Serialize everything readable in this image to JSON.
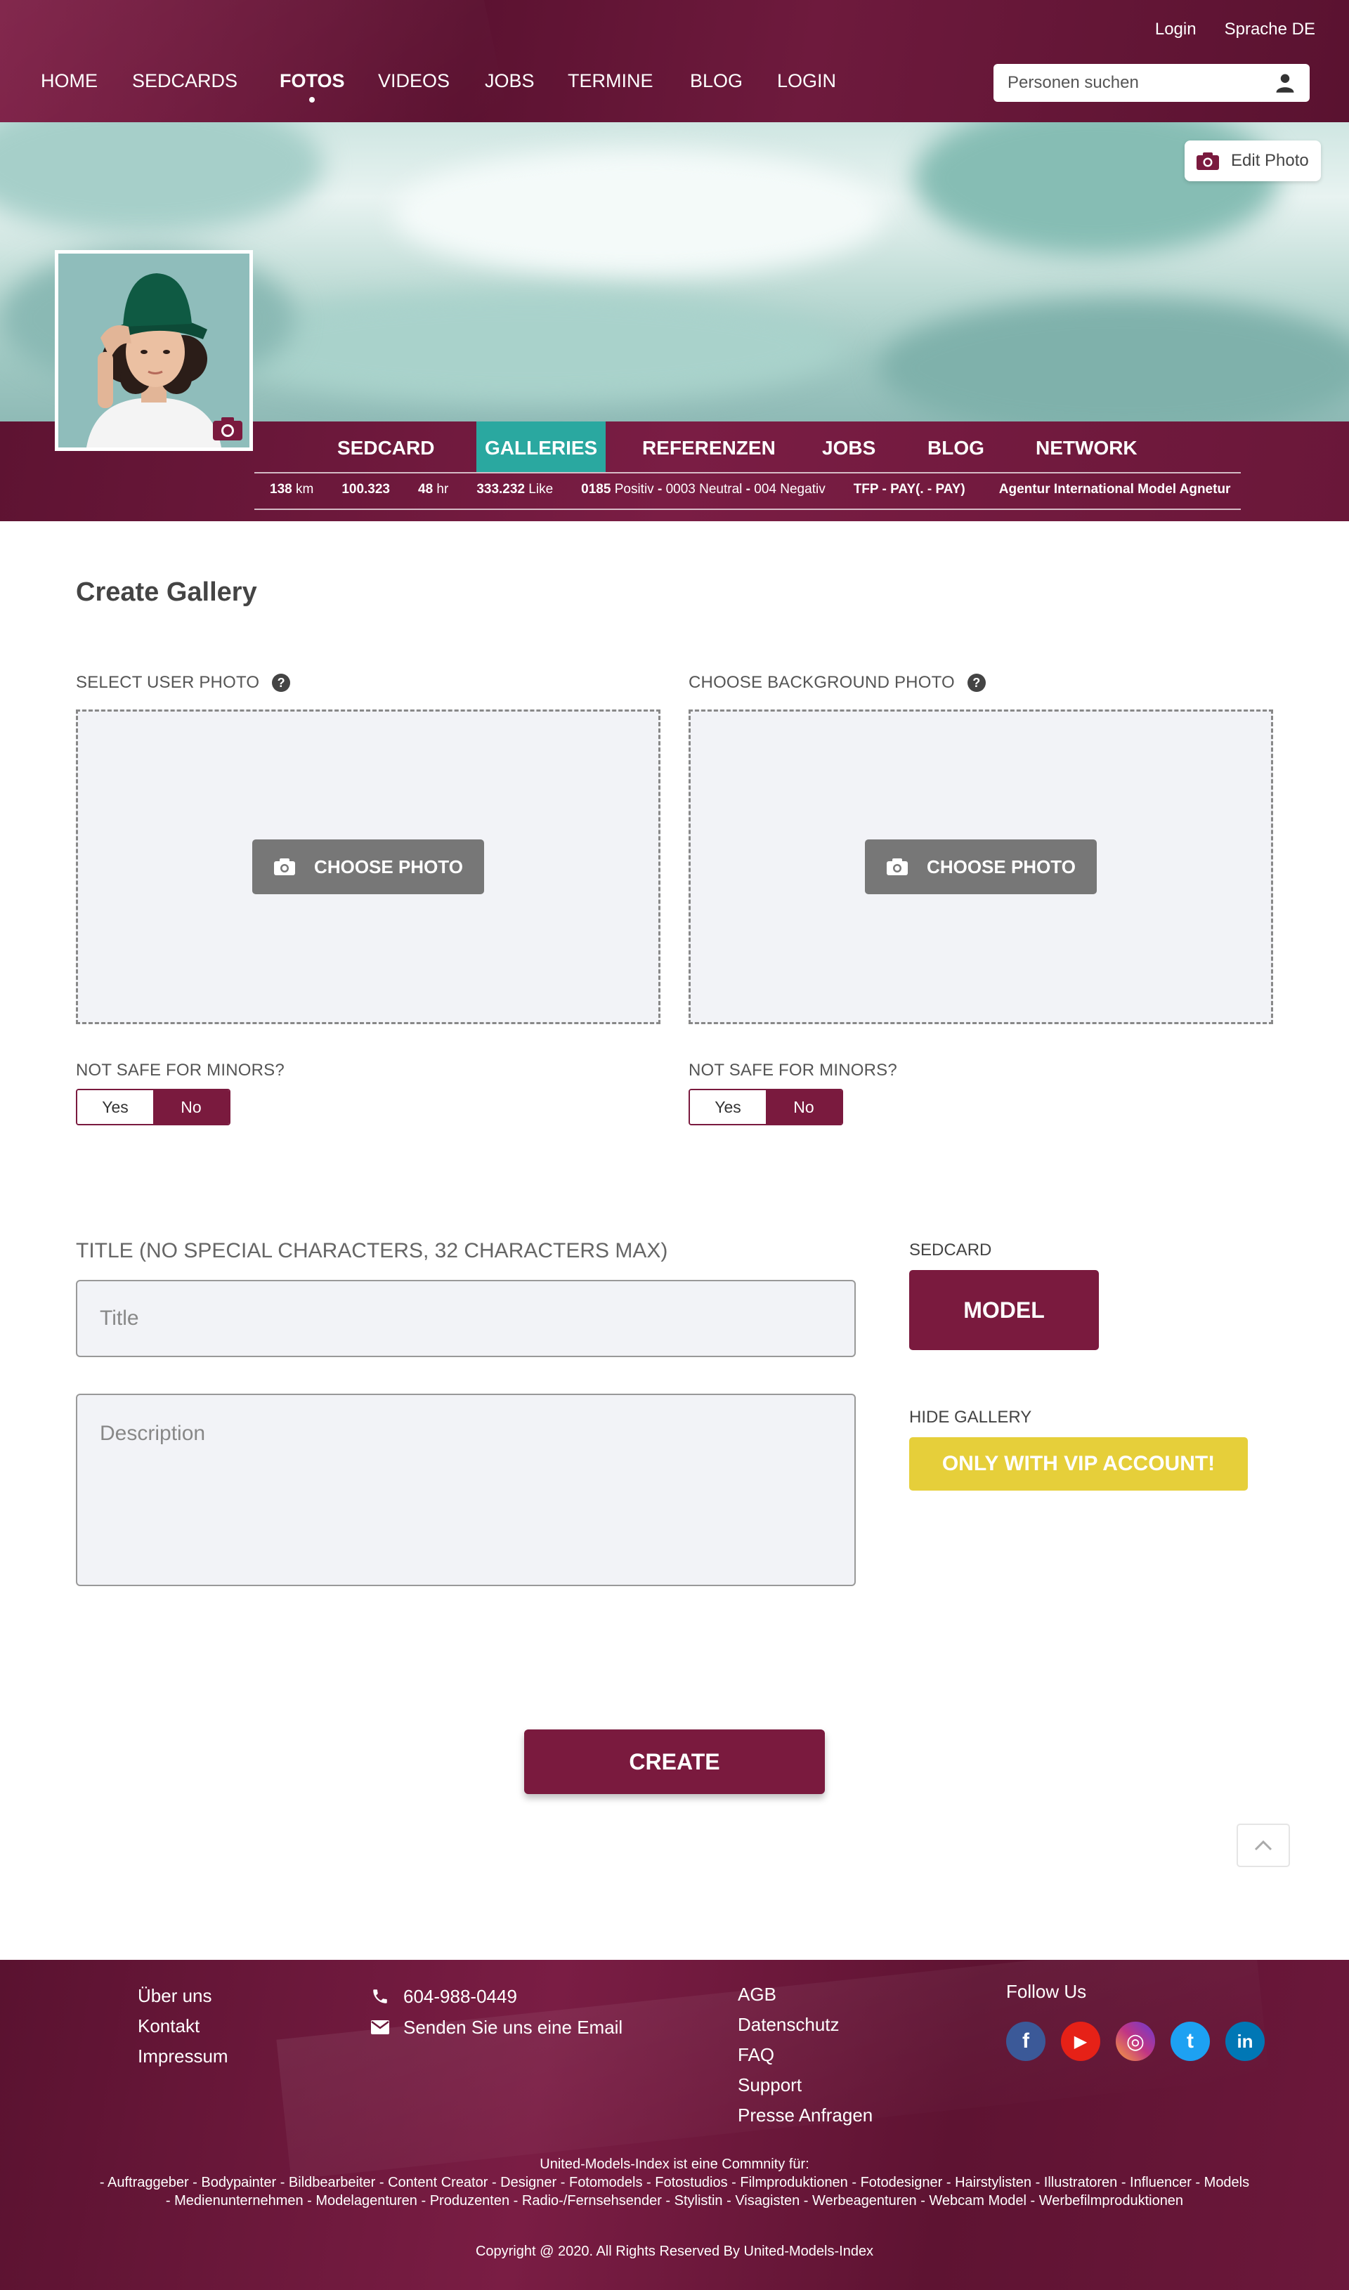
{
  "colors": {
    "brand": "#7a1a3e",
    "brand_dark": "#5c1231",
    "accent_teal": "#2aa8a0",
    "vip_yellow": "#e6cf3a",
    "dropzone_bg": "#f2f3f7"
  },
  "header": {
    "top_links": [
      "Login",
      "Sprache DE"
    ],
    "nav": [
      {
        "label": "HOME",
        "active": false
      },
      {
        "label": "SEDCARDS",
        "active": false
      },
      {
        "label": "FOTOS",
        "active": true
      },
      {
        "label": "VIDEOS",
        "active": false
      },
      {
        "label": "JOBS",
        "active": false
      },
      {
        "label": "TERMINE",
        "active": false
      },
      {
        "label": "BLOG",
        "active": false
      },
      {
        "label": "LOGIN",
        "active": false
      }
    ],
    "search": {
      "placeholder": "Personen suchen",
      "icon": "person-icon"
    }
  },
  "cover": {
    "edit_label": "Edit Photo",
    "edit_icon": "camera-icon"
  },
  "profile": {
    "tabs": [
      {
        "label": "SEDCARD",
        "active": false
      },
      {
        "label": "GALLERIES",
        "active": true
      },
      {
        "label": "REFERENZEN",
        "active": false
      },
      {
        "label": "JOBS",
        "active": false
      },
      {
        "label": "BLOG",
        "active": false
      },
      {
        "label": "NETWORK",
        "active": false
      }
    ],
    "stats": {
      "distance_value": "138",
      "distance_unit": "km",
      "views": "100.323",
      "hours_value": "48",
      "hours_unit": "hr",
      "likes_value": "333.232",
      "likes_unit": "Like",
      "positive_value": "0185",
      "positive_unit": "Positiv",
      "neutral_value": "0003",
      "neutral_unit": "Neutral",
      "negative_value": "004",
      "negative_unit": "Negativ",
      "separator": "-",
      "tfp": "TFP - PAY(. - PAY)",
      "agency": "Agentur International Model Agnetur"
    }
  },
  "form": {
    "title": "Create Gallery",
    "user_photo": {
      "label": "SELECT USER PHOTO",
      "help": "?",
      "button": "CHOOSE PHOTO",
      "nsfw_label": "NOT SAFE FOR MINORS?",
      "yes": "Yes",
      "no": "No",
      "selected": "No"
    },
    "background_photo": {
      "label": "CHOOSE BACKGROUND PHOTO",
      "help": "?",
      "button": "CHOOSE PHOTO",
      "nsfw_label": "NOT SAFE FOR MINORS?",
      "yes": "Yes",
      "no": "No",
      "selected": "No"
    },
    "title_label": "TITLE (NO SPECIAL CHARACTERS, 32 CHARACTERS MAX)",
    "title_placeholder": "Title",
    "title_value": "",
    "description_placeholder": "Description",
    "description_value": "",
    "sedcard_label": "SEDCARD",
    "sedcard_value": "MODEL",
    "hide_label": "HIDE GALLERY",
    "hide_button": "ONLY WITH VIP ACCOUNT!",
    "create_button": "CREATE"
  },
  "scroll_top": {
    "icon": "chevron-up-icon"
  },
  "footer": {
    "col1": [
      "Über uns",
      "Kontakt",
      "Impressum"
    ],
    "phone": "604-988-0449",
    "email": "Senden Sie uns eine Email",
    "col3": [
      "AGB",
      "Datenschutz",
      "FAQ",
      "Support",
      "Presse Anfragen"
    ],
    "follow": "Follow Us",
    "socials": [
      {
        "name": "facebook",
        "glyph": "f",
        "color": "#3b5998"
      },
      {
        "name": "youtube",
        "glyph": "▶",
        "color": "#e62117"
      },
      {
        "name": "instagram",
        "glyph": "◎",
        "color": "#c13584"
      },
      {
        "name": "twitter",
        "glyph": "t",
        "color": "#1da1f2"
      },
      {
        "name": "linkedin",
        "glyph": "in",
        "color": "#0077b5"
      }
    ],
    "community_intro": "United-Models-Index ist eine Commnity für:",
    "community_line1": "- Auftraggeber - Bodypainter - Bildbearbeiter - Content Creator - Designer - Fotomodels - Fotostudios - Filmproduktionen - Fotodesigner - Hairstylisten - Illustratoren - Influencer - Models",
    "community_line2": "- Medienunternehmen - Modelagenturen - Produzenten - Radio-/Fernsehsender - Stylistin - Visagisten - Werbeagenturen - Webcam Model - Werbefilmproduktionen",
    "copyright": "Copyright @ 2020. All Rights Reserved By United-Models-Index"
  }
}
